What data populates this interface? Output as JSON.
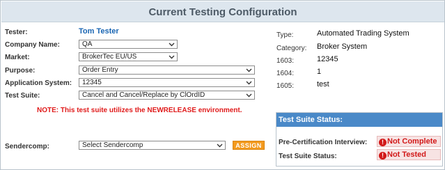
{
  "title": "Current Testing Configuration",
  "form": {
    "tester_label": "Tester:",
    "tester_value": "Tom Tester",
    "company_label": "Company Name:",
    "company_value": "QA",
    "market_label": "Market:",
    "market_value": "BrokerTec EU/US",
    "purpose_label": "Purpose:",
    "purpose_value": "Order Entry",
    "appsys_label": "Application System:",
    "appsys_value": "12345",
    "suite_label": "Test Suite:",
    "suite_value": "Cancel and Cancel/Replace by ClOrdID",
    "note": "NOTE: This test suite utilizes the NEWRELEASE environment.",
    "sendercomp_label": "Sendercomp:",
    "sendercomp_value": "Select Sendercomp",
    "assign_label": "ASSIGN"
  },
  "info": {
    "type_label": "Type:",
    "type_value": "Automated Trading System",
    "category_label": "Category:",
    "category_value": "Broker System",
    "f1603_label": "1603:",
    "f1603_value": "12345",
    "f1604_label": "1604:",
    "f1604_value": "1",
    "f1605_label": "1605:",
    "f1605_value": "test"
  },
  "status": {
    "header": "Test Suite Status:",
    "precert_label": "Pre-Certification Interview:",
    "precert_value": "Not Complete",
    "suite_status_label": "Test Suite Status:",
    "suite_status_value": "Not Tested",
    "badge_icon": "!"
  },
  "colors": {
    "accent": "#4a89c8",
    "title_bg": "#dde6ee",
    "assign": "#f39a1e",
    "error": "#d21919",
    "tester": "#1a66b3"
  }
}
